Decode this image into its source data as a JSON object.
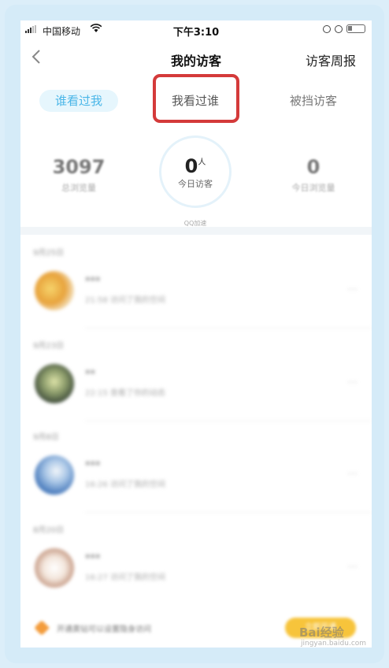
{
  "status_bar": {
    "carrier": "中国移动",
    "time": "下午3:10",
    "icons": [
      "signal-icon",
      "wifi-icon",
      "lock-rotation-icon",
      "alarm-icon",
      "battery-icon"
    ]
  },
  "nav": {
    "back_icon": "chevron-left-icon",
    "title": "我的访客",
    "right_label": "访客周报"
  },
  "tabs": [
    {
      "label": "谁看过我",
      "active": true
    },
    {
      "label": "我看过谁",
      "active": false,
      "highlighted": true
    },
    {
      "label": "被挡访客",
      "active": false
    }
  ],
  "stats": {
    "total_views": {
      "value": "3097",
      "label": "总浏览量"
    },
    "today_visitors": {
      "value": "0",
      "unit": "人",
      "label": "今日访客",
      "badge": "QQ加速"
    },
    "today_views": {
      "value": "0",
      "label": "今日浏览量"
    }
  },
  "visitors": [
    {
      "date": "9月25日",
      "name": "***",
      "detail": "21:58 访问了我的空间"
    },
    {
      "date": "9月23日",
      "name": "**",
      "detail": "22:15 查看了你的动态"
    },
    {
      "date": "9月8日",
      "name": "***",
      "detail": "16:26 访问了我的空间"
    },
    {
      "date": "8月20日",
      "name": "***",
      "detail": "16:27 访问了我的空间"
    }
  ],
  "bottom_bar": {
    "text": "开通黄钻可以设置隐身访问",
    "button": "立即开通"
  },
  "watermark": {
    "text": "Bai经验",
    "url": "jingyan.baidu.com"
  },
  "colors": {
    "accent_blue": "#4ab6e8",
    "highlight_red": "#d43a3a",
    "vip_yellow": "#f7c43b"
  }
}
